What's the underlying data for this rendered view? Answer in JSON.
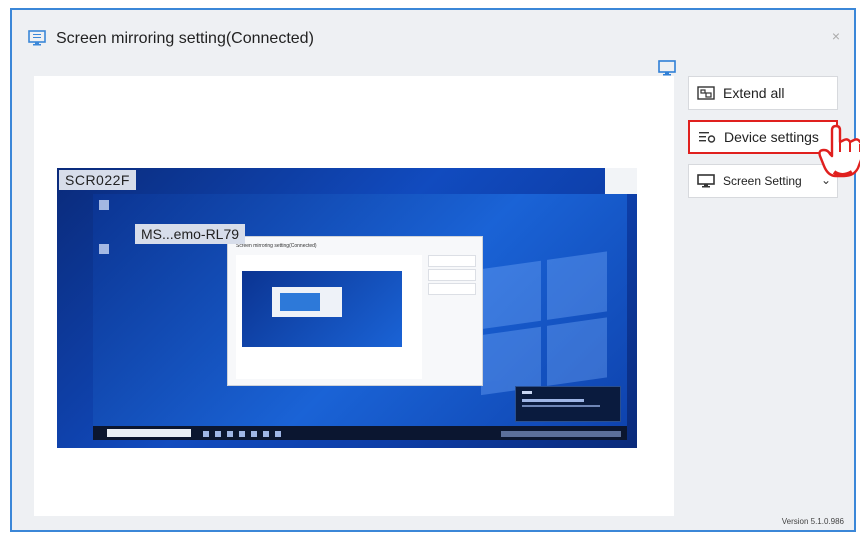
{
  "window": {
    "title": "Screen mirroring setting(Connected)",
    "close_glyph": "×",
    "version": "Version 5.1.0.986",
    "accent": "#3b87d8",
    "highlight": "#e0201e"
  },
  "sidebar": {
    "extend_all": "Extend all",
    "device_settings": "Device settings",
    "screen_setting": "Screen Setting",
    "screen_setting_chevron": "⌄"
  },
  "preview": {
    "device_label": "SCR022F",
    "remote_label": "MS...emo-RL79",
    "nested_title": "Screen mirroring setting(Connected)"
  },
  "icons": {
    "title": "screen-mirror-icon",
    "monitor": "monitor-icon",
    "extend": "extend-all-icon",
    "device": "device-settings-icon",
    "screen": "screen-setting-icon",
    "pointer": "hand-pointer-icon",
    "close": "close-icon"
  }
}
